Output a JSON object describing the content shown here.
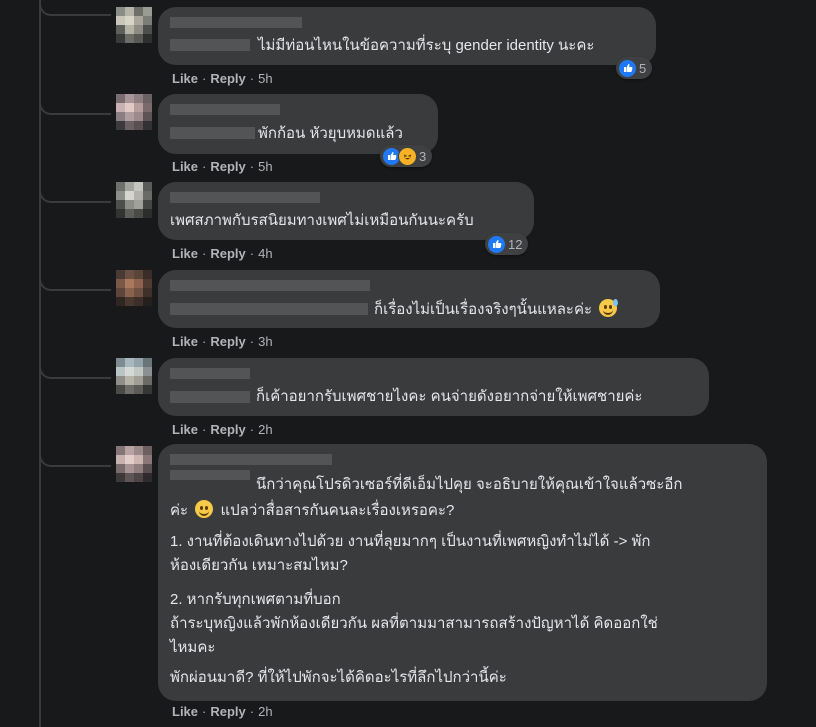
{
  "comments": [
    {
      "lines": [
        "ไม่มีท่อนไหนในข้อความที่ระบุ gender identity นะคะ"
      ],
      "reaction_count": "5",
      "reaction_types": [
        "like-icon"
      ],
      "time": "5h"
    },
    {
      "lines": [
        "พักก้อน หัวยุบหมดแล้ว"
      ],
      "reaction_count": "3",
      "reaction_types": [
        "like-icon",
        "haha-icon"
      ],
      "time": "5h"
    },
    {
      "lines": [
        "เพศสภาพกับรสนิยมทางเพศไม่เหมือนกันนะครับ"
      ],
      "reaction_count": "12",
      "reaction_types": [
        "like-icon"
      ],
      "time": "4h"
    },
    {
      "lines": [
        "ก็เรื่องไม่เป็นเรื่องจริงๆนั้นแหละค่ะ"
      ],
      "time": "3h"
    },
    {
      "lines": [
        "ก็เค้าอยากรับเพศชายไงคะ คนจ่ายดังอยากจ่ายให้เพศชายค่ะ"
      ],
      "time": "2h"
    },
    {
      "line1": "นึกว่าคุณโปรดิวเซอร์ที่ดีเอ็มไปคุย จะอธิบายให้คุณเข้าใจแล้วซะอีก",
      "line2a": "ค่ะ",
      "line2b": "แปลว่าสื่อสารกันคนละเรื่องเหรอคะ?",
      "p2l1": "1. งานที่ต้องเดินทางไปด้วย งานที่ลุยมากๆ เป็นงานที่เพศหญิงทำไม่ได้ -> พัก",
      "p2l2": "ห้องเดียวกัน เหมาะสมไหม?",
      "p3l1": "2. หากรับทุกเพศตามที่บอก",
      "p3l2": "ถ้าระบุหญิงแล้วพักห้องเดียวกัน ผลที่ตามมาสามารถสร้างปัญหาได้ คิดออกใช่",
      "p3l3": "ไหมคะ",
      "p4l1": "พักผ่อนมาดี? ที่ให้ไปพักจะได้คิดอะไรที่ลึกไปกว่านี้ค่ะ",
      "time": "2h"
    }
  ],
  "actions": {
    "like": "Like",
    "reply": "Reply",
    "separator": "·"
  },
  "colors": {
    "background": "#18191a",
    "bubble": "#3a3b3c",
    "text": "#e4e6eb",
    "meta": "#b0b3b8",
    "like_blue": "#2078f4"
  }
}
